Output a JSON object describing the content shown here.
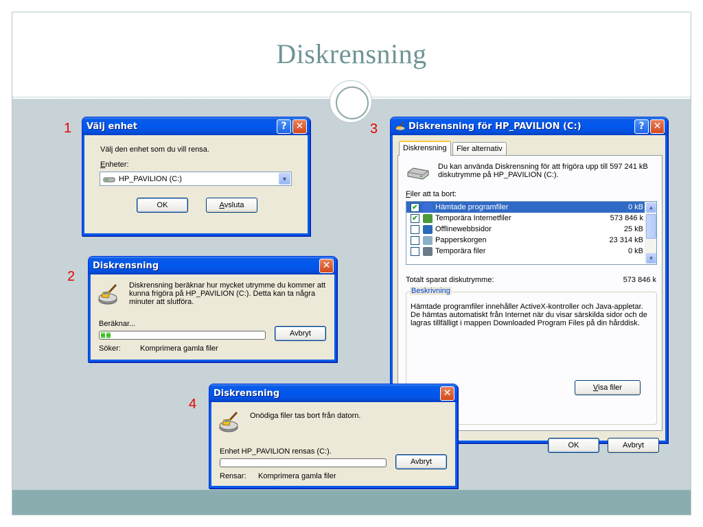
{
  "slide": {
    "title": "Diskrensning",
    "accent": "#6e9494",
    "content_bg": "#c7d3d7",
    "footer_bg": "#8aadb0"
  },
  "steps": [
    "1",
    "2",
    "3",
    "4"
  ],
  "win1": {
    "title": "Välj enhet",
    "prompt": "Välj den enhet som du vill rensa.",
    "drives_label_u": "E",
    "drives_label_rest": "nheter:",
    "selected_drive": "HP_PAVILION (C:)",
    "ok": "OK",
    "cancel_u": "A",
    "cancel_rest": "vsluta"
  },
  "win2": {
    "title": "Diskrensning",
    "message": "Diskrensning beräknar hur mycket utrymme du kommer att kunna frigöra på HP_PAVILION (C:). Detta kan ta några minuter att slutföra.",
    "status_label": "Beräknar...",
    "progress_percent": 8,
    "cancel": "Avbryt",
    "search_label": "Söker:",
    "search_value": "Komprimera gamla filer"
  },
  "win3": {
    "title": "Diskrensning för HP_PAVILION (C:)",
    "tabs": [
      "Diskrensning",
      "Fler alternativ"
    ],
    "intro": "Du kan använda Diskrensning för att frigöra upp till 597 241 kB diskutrymme på HP_PAVILION (C:).",
    "files_label_u": "F",
    "files_label_rest": "iler att ta bort:",
    "files": [
      {
        "name": "Hämtade programfiler",
        "size": "0 kB",
        "checked": true,
        "selected": true,
        "icon": "downloaded-programs-icon"
      },
      {
        "name": "Temporära Internetfiler",
        "size": "573 846 k",
        "checked": true,
        "selected": false,
        "icon": "internet-files-icon"
      },
      {
        "name": "Offlinewebbsidor",
        "size": "25 kB",
        "checked": false,
        "selected": false,
        "icon": "offline-pages-icon"
      },
      {
        "name": "Papperskorgen",
        "size": "23 314 kB",
        "checked": false,
        "selected": false,
        "icon": "recycle-bin-icon"
      },
      {
        "name": "Temporära filer",
        "size": "0 kB",
        "checked": false,
        "selected": false,
        "icon": "temp-files-icon"
      }
    ],
    "total_label": "Totalt sparat diskutrymme:",
    "total_value": "573 846 k",
    "description_title": "Beskrivning",
    "description": "Hämtade programfiler innehåller ActiveX-kontroller och Java-appletar. De hämtas automatiskt från Internet när du visar särskilda sidor och de lagras tillfälligt i mappen Downloaded Program Files på din hårddisk.",
    "view_files_u": "V",
    "view_files_rest": "isa filer",
    "ok": "OK",
    "cancel": "Avbryt"
  },
  "win4": {
    "title": "Diskrensning",
    "message": "Onödiga filer tas bort från datorn.",
    "status_label": "Enhet HP_PAVILION rensas (C:).",
    "progress_percent": 0,
    "cancel": "Avbryt",
    "clean_label": "Rensar:",
    "clean_value": "Komprimera gamla filer"
  }
}
